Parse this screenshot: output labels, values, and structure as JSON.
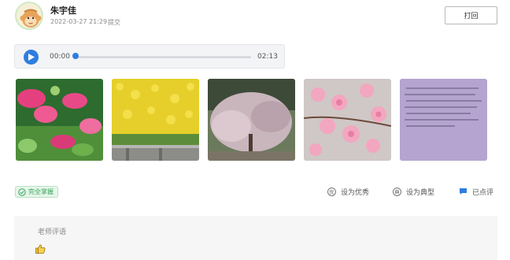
{
  "header": {
    "student_name": "朱宇佳",
    "submit_time": "2022-03-27 21:29",
    "submit_status": "提交",
    "print_label": "打回"
  },
  "audio": {
    "current_time": "00:00",
    "total_time": "02:13",
    "progress": 0.0
  },
  "photos": [
    {
      "icon": "photo-pink-flowers"
    },
    {
      "icon": "photo-yellow-flowers"
    },
    {
      "icon": "photo-blossom-tree"
    },
    {
      "icon": "photo-peach-blossom"
    },
    {
      "icon": "photo-handwritten-text"
    }
  ],
  "status": {
    "badge_label": "完全掌握",
    "mark_excellent": "设为优秀",
    "mark_typical": "设为典型",
    "commented": "已点评"
  },
  "comment": {
    "title": "老师评语"
  },
  "colors": {
    "accent": "#2f7de1",
    "badge_green": "#3aa35a"
  }
}
